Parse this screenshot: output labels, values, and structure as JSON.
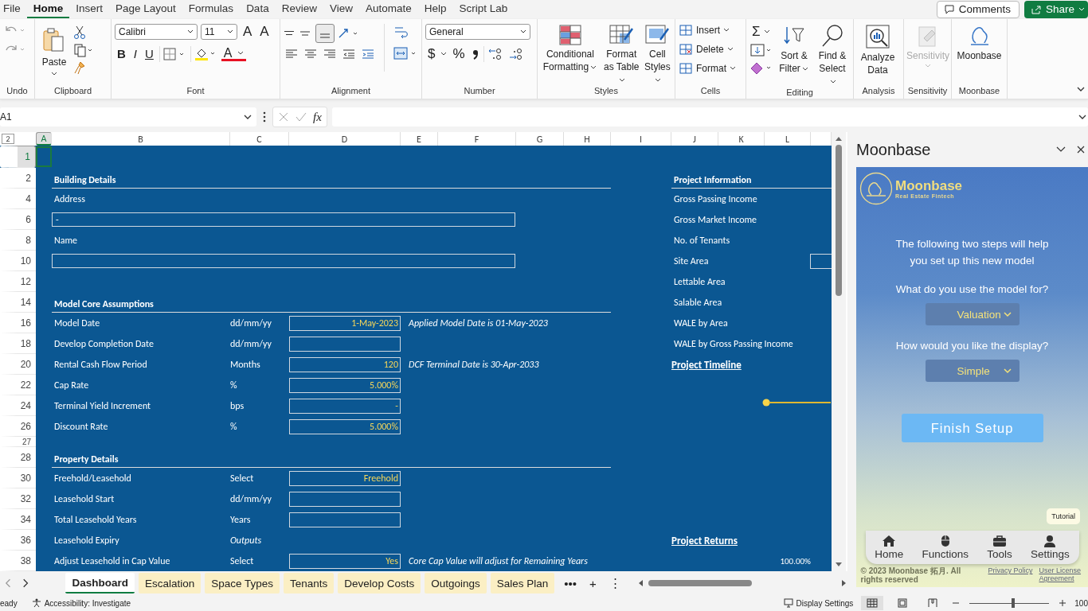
{
  "menu_tabs": [
    {
      "label": "File",
      "selected": false
    },
    {
      "label": "Home",
      "selected": true
    },
    {
      "label": "Insert",
      "selected": false
    },
    {
      "label": "Page Layout",
      "selected": false
    },
    {
      "label": "Formulas",
      "selected": false
    },
    {
      "label": "Data",
      "selected": false
    },
    {
      "label": "Review",
      "selected": false
    },
    {
      "label": "View",
      "selected": false
    },
    {
      "label": "Automate",
      "selected": false
    },
    {
      "label": "Help",
      "selected": false
    },
    {
      "label": "Script Lab",
      "selected": false
    }
  ],
  "header_buttons": {
    "comments": "Comments",
    "share": "Share"
  },
  "ribbon": {
    "groups": [
      "Undo",
      "Clipboard",
      "Font",
      "Alignment",
      "Number",
      "Styles",
      "Cells",
      "Editing",
      "Analysis",
      "Sensitivity",
      "Moonbase"
    ],
    "paste": "Paste",
    "font_family": "Calibri",
    "font_size": "11",
    "size_buttons": [
      "A",
      "A"
    ],
    "format_buttons": [
      "B",
      "I",
      "U"
    ],
    "font_color_letter": "A",
    "number_format": "General",
    "number_buttons": [
      "$",
      "%"
    ],
    "style_buttons": [
      "Conditional Formatting",
      "Format as Table",
      "Cell Styles"
    ],
    "cell_buttons": [
      "Insert",
      "Delete",
      "Format"
    ],
    "autosum": "Σ",
    "editing_buttons": [
      "Sort & Filter",
      "Find & Select"
    ],
    "analyze": "Analyze Data",
    "sensitivity": {
      "label": "Sensitivity",
      "disabled": true
    },
    "moonbase": "Moonbase"
  },
  "formula_bar": {
    "name_box": "A1",
    "fx": "fx"
  },
  "sheet": {
    "outline_level": "2",
    "columns": [
      "A",
      "B",
      "C",
      "D",
      "E",
      "F",
      "G",
      "H",
      "I",
      "J",
      "K",
      "L",
      ""
    ],
    "rows": [
      {
        "number": "1",
        "selected_cell": true
      },
      {
        "number": "2",
        "left": {
          "kind": "heading",
          "text": "Building Details"
        },
        "right": {
          "kind": "heading",
          "text": "Project Information"
        }
      },
      {
        "number": "4",
        "left": {
          "kind": "label",
          "text": "Address"
        },
        "right": {
          "kind": "label",
          "text": "Gross Passing Income"
        }
      },
      {
        "number": "6",
        "left": {
          "kind": "wide_input",
          "value": "-"
        },
        "right": {
          "kind": "label",
          "text": "Gross Market Income"
        }
      },
      {
        "number": "8",
        "left": {
          "kind": "label",
          "text": "Name"
        },
        "right": {
          "kind": "label",
          "text": "No. of Tenants"
        }
      },
      {
        "number": "10",
        "left": {
          "kind": "wide_input"
        },
        "right": {
          "kind": "label",
          "text": "Site Area",
          "has_box": true
        }
      },
      {
        "number": "12",
        "right": {
          "kind": "label",
          "text": "Lettable Area"
        }
      },
      {
        "number": "14",
        "left": {
          "kind": "heading",
          "text": "Model Core Assumptions"
        },
        "right": {
          "kind": "label",
          "text": "Salable Area"
        }
      },
      {
        "number": "16",
        "left": {
          "kind": "field",
          "text": "Model Date",
          "unit": "dd/mm/yy",
          "value": "1-May-2023",
          "note": "Applied Model Date is 01-May-2023"
        },
        "right": {
          "kind": "label",
          "text": "WALE by Area"
        }
      },
      {
        "number": "18",
        "left": {
          "kind": "field",
          "text": "Develop Completion Date",
          "unit": "dd/mm/yy"
        },
        "right": {
          "kind": "label",
          "text": "WALE by Gross Passing Income"
        }
      },
      {
        "number": "20",
        "left": {
          "kind": "field",
          "text": "Rental Cash Flow Period",
          "unit": "Months",
          "value": "120",
          "note": "DCF Terminal Date is 30-Apr-2033"
        },
        "right": {
          "kind": "section_title",
          "text": "Project Timeline"
        }
      },
      {
        "number": "22",
        "left": {
          "kind": "field",
          "text": "Cap Rate",
          "unit": "%",
          "value": "5.000%"
        }
      },
      {
        "number": "24",
        "left": {
          "kind": "field",
          "text": "Terminal Yield Increment",
          "unit": "bps",
          "value": "-"
        },
        "right": {
          "kind": "timeline"
        }
      },
      {
        "number": "26",
        "left": {
          "kind": "field",
          "text": "Discount Rate",
          "unit": "%",
          "value": "5.000%"
        }
      },
      {
        "number": "27",
        "small": true
      },
      {
        "number": "28",
        "left": {
          "kind": "heading",
          "text": "Property Details"
        }
      },
      {
        "number": "30",
        "left": {
          "kind": "field",
          "text": "Freehold/Leasehold",
          "unit": "Select",
          "value": "Freehold"
        }
      },
      {
        "number": "32",
        "left": {
          "kind": "field",
          "text": "Leasehold Start",
          "unit": "dd/mm/yy"
        }
      },
      {
        "number": "34",
        "left": {
          "kind": "field",
          "text": "Total Leasehold Years",
          "unit": "Years"
        }
      },
      {
        "number": "36",
        "left": {
          "kind": "output",
          "text": "Leasehold Expiry",
          "unit": "Outputs"
        },
        "right": {
          "kind": "section_title",
          "text": "Project Returns"
        }
      },
      {
        "number": "38",
        "left": {
          "kind": "field",
          "text": "Adjust Leasehold in Cap Value",
          "unit": "Select",
          "value": "Yes",
          "note": "Core Cap Value will adjust for Remaining Years"
        },
        "right": {
          "kind": "value",
          "text": "100.00%"
        }
      }
    ]
  },
  "sheet_tabs": [
    {
      "label": "Dashboard",
      "selected": true
    },
    {
      "label": "Escalation",
      "selected": false
    },
    {
      "label": "Space Types",
      "selected": false
    },
    {
      "label": "Tenants",
      "selected": false
    },
    {
      "label": "Develop Costs",
      "selected": false
    },
    {
      "label": "Outgoings",
      "selected": false
    },
    {
      "label": "Sales Plan",
      "selected": false
    }
  ],
  "tab_controls": [
    "•••",
    "+",
    "⋮"
  ],
  "status_bar": {
    "mode": "eady",
    "accessibility": "Accessibility: Investigate",
    "display_settings": "Display Settings",
    "zoom": {
      "level": 0.53,
      "reading": "100"
    }
  },
  "taskpane": {
    "title": "Moonbase",
    "brand": "Moonbase",
    "tagline": "Real Estate Fintech",
    "intro": "The following two steps will help you set up this new model",
    "questions": [
      {
        "text": "What do you use the model for?",
        "answer": "Valuation"
      },
      {
        "text": "How would you like the display?",
        "answer": "Simple"
      }
    ],
    "finish": "Finish Setup",
    "tutorial": "Tutorial",
    "nav": [
      "Home",
      "Functions",
      "Tools",
      "Settings"
    ],
    "copyright": "© 2023 Moonbase 拓月. All rights reserved",
    "links": [
      "Privacy Policy",
      "User License Agreement"
    ]
  }
}
